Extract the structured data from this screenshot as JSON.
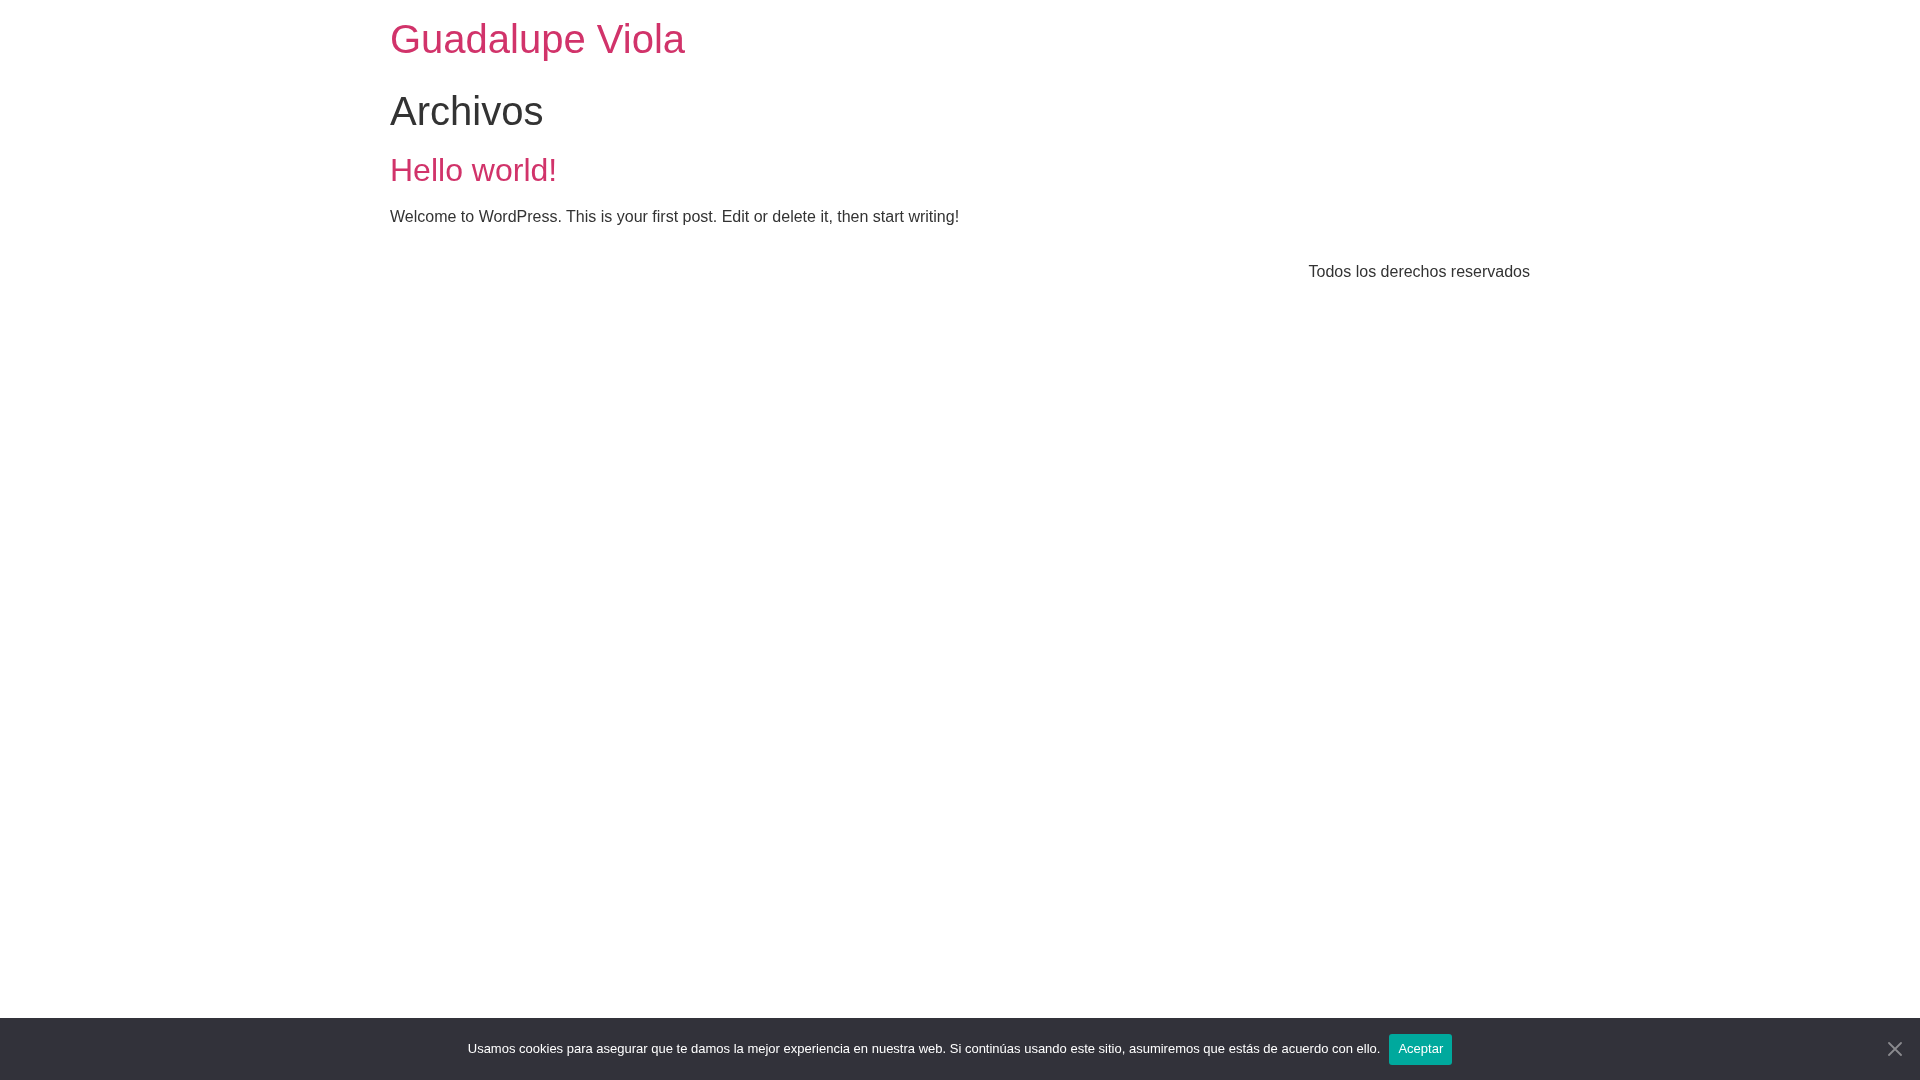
{
  "site": {
    "title": "Guadalupe Viola"
  },
  "page": {
    "heading": "Archivos"
  },
  "posts": [
    {
      "title": "Hello world!",
      "excerpt": "Welcome to WordPress. This is your first post. Edit or delete it, then start writing!"
    }
  ],
  "footer": {
    "text": "Todos los derechos reservados"
  },
  "cookie_notice": {
    "message": "Usamos cookies para asegurar que te damos la mejor experiencia en nuestra web. Si continúas usando este sitio, asumiremos que estás de acuerdo con ello.",
    "button": "Aceptar"
  }
}
